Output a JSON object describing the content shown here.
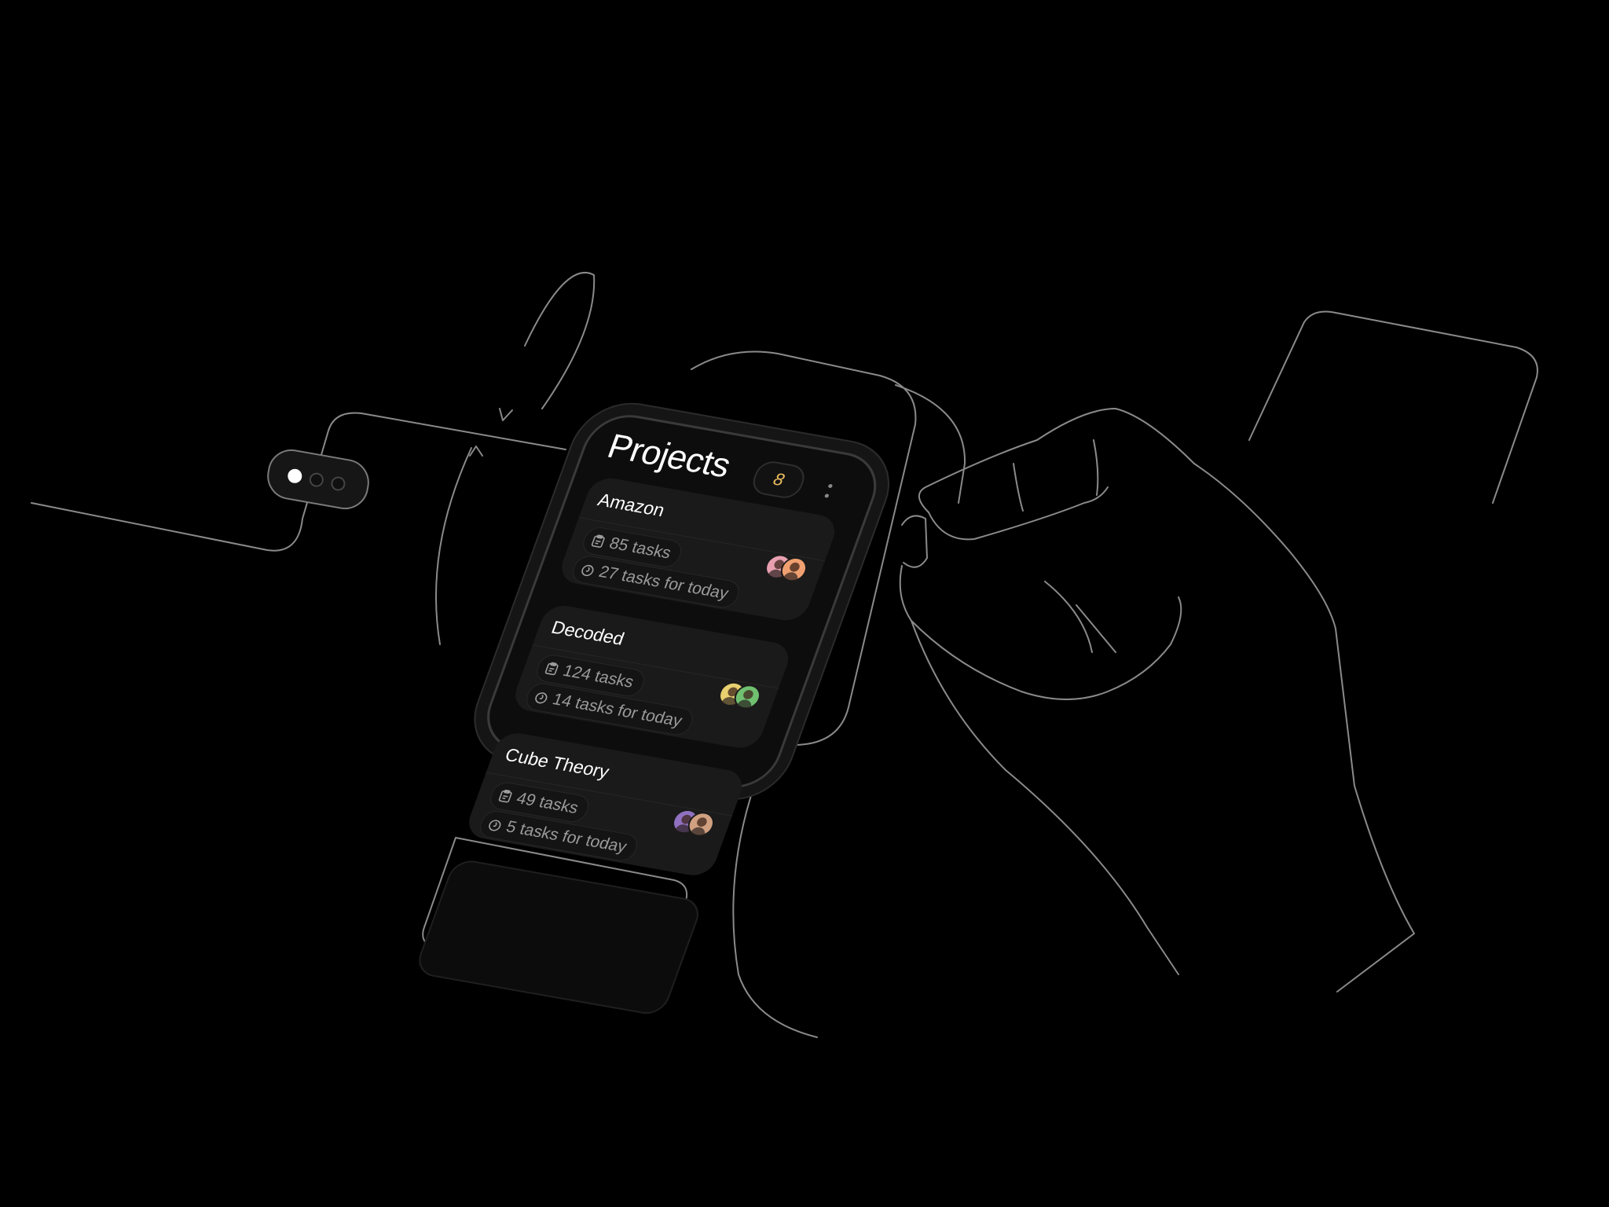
{
  "screen": {
    "title": "Projects",
    "project_count": "8"
  },
  "projects": [
    {
      "name": "Amazon",
      "tasks": "85 tasks",
      "today": "27 tasks for today",
      "avatar_colors": [
        "#e8a0b0",
        "#f0a070"
      ]
    },
    {
      "name": "Decoded",
      "tasks": "124 tasks",
      "today": "14 tasks for today",
      "avatar_colors": [
        "#e8d070",
        "#70c070"
      ]
    },
    {
      "name": "Cube Theory",
      "tasks": "49 tasks",
      "today": "5 tasks for today",
      "avatar_colors": [
        "#9070c0",
        "#d0a080"
      ]
    }
  ],
  "pager": {
    "active_index": 0,
    "count": 3
  },
  "colors": {
    "background": "#000000",
    "badge_text": "#f0c060",
    "card": "#1a1a1a",
    "line_art": "#8a8a8a"
  },
  "icons": {
    "tasks": "clipboard-icon",
    "today": "timer-flame-icon",
    "more": "more-vertical-icon"
  }
}
